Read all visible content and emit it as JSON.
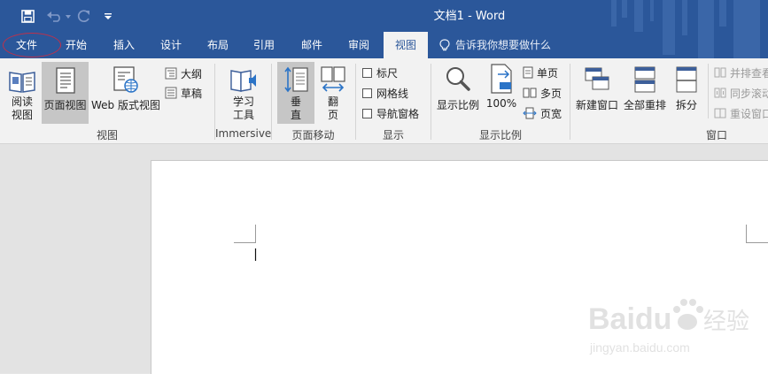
{
  "window": {
    "title": "文档1  -  Word"
  },
  "qat": {
    "save": "save-icon",
    "undo": "undo-icon",
    "redo": "redo-icon",
    "customize": "customize-qat-icon"
  },
  "tabs": [
    "文件",
    "开始",
    "插入",
    "设计",
    "布局",
    "引用",
    "邮件",
    "审阅",
    "视图"
  ],
  "active_tab": "视图",
  "tell_me": "告诉我你想要做什么",
  "ribbon": {
    "views": {
      "label": "视图",
      "read_mode": "阅读\n视图",
      "print_layout": "页面视图",
      "web_layout": "Web 版式视图",
      "outline": "大纲",
      "draft": "草稿"
    },
    "immersive": {
      "label": "Immersive",
      "learning_tools": "学习\n工具"
    },
    "page_movement": {
      "label": "页面移动",
      "vertical": "垂\n直",
      "side_to_side": "翻\n页"
    },
    "show": {
      "label": "显示",
      "ruler": "标尺",
      "gridlines": "网格线",
      "nav_pane": "导航窗格"
    },
    "zoom": {
      "label": "显示比例",
      "zoom": "显示比例",
      "hundred": "100%",
      "one_page": "单页",
      "multiple_pages": "多页",
      "page_width": "页宽"
    },
    "window": {
      "label": "窗口",
      "new_window": "新建窗口",
      "arrange_all": "全部重排",
      "split": "拆分",
      "view_side_by_side": "并排查看",
      "sync_scroll": "同步滚动",
      "reset_position": "重设窗口位置"
    }
  },
  "watermark": {
    "brand": "Baidu",
    "cn": "经验",
    "url": "jingyan.baidu.com"
  },
  "colors": {
    "title_bar": "#2b579a",
    "ribbon_bg": "#f2f2f2",
    "annotation": "#c0304a"
  }
}
